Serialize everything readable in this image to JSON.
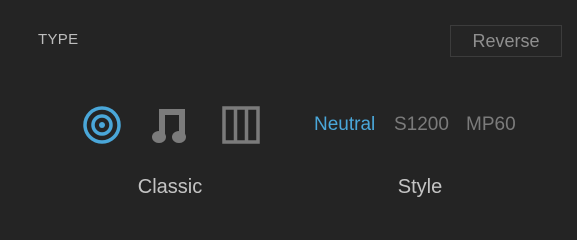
{
  "panel": {
    "title": "TYPE",
    "reverse_label": "Reverse"
  },
  "type_icons": [
    {
      "icon": "target-circle-icon",
      "selected": true
    },
    {
      "icon": "music-note-icon",
      "selected": false
    },
    {
      "icon": "grid-columns-icon",
      "selected": false
    }
  ],
  "style_options": [
    {
      "label": "Neutral",
      "selected": true
    },
    {
      "label": "S1200",
      "selected": false
    },
    {
      "label": "MP60",
      "selected": false
    }
  ],
  "labels": {
    "classic": "Classic",
    "style": "Style"
  },
  "colors": {
    "accent": "#4aa7d9",
    "inactive": "#7b7b7b",
    "background": "#242424"
  }
}
